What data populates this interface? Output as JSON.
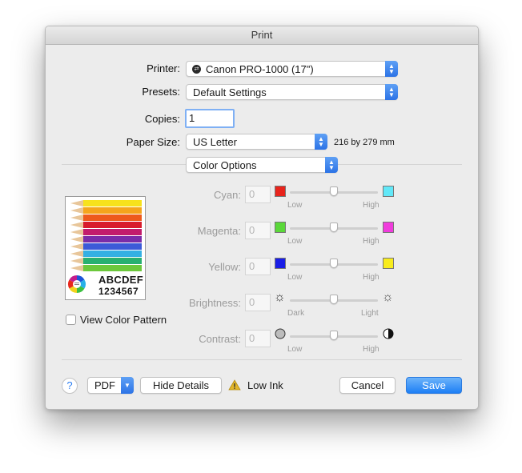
{
  "window": {
    "title": "Print"
  },
  "printer": {
    "label": "Printer:",
    "value": "Canon PRO-1000 (17\")"
  },
  "presets": {
    "label": "Presets:",
    "value": "Default Settings"
  },
  "copies": {
    "label": "Copies:",
    "value": "1"
  },
  "paper_size": {
    "label": "Paper Size:",
    "value": "US Letter",
    "dimensions": "216 by 279 mm"
  },
  "section": {
    "value": "Color Options"
  },
  "preview": {
    "text_line1": "ABCDEF",
    "text_line2": "1234567"
  },
  "view_color_pattern": {
    "label": "View Color Pattern",
    "checked": false
  },
  "sliders": [
    {
      "name": "Cyan:",
      "value": "0",
      "low_label": "Low",
      "high_label": "High",
      "left_color": "#e8241c",
      "right_color": "#62e8f8",
      "left_icon": "red-swatch-icon",
      "right_icon": "cyan-swatch-icon"
    },
    {
      "name": "Magenta:",
      "value": "0",
      "low_label": "Low",
      "high_label": "High",
      "left_color": "#5bd83a",
      "right_color": "#f03cdc",
      "left_icon": "green-swatch-icon",
      "right_icon": "magenta-swatch-icon"
    },
    {
      "name": "Yellow:",
      "value": "0",
      "low_label": "Low",
      "high_label": "High",
      "left_color": "#1a1ee6",
      "right_color": "#f8ec1c",
      "left_icon": "blue-swatch-icon",
      "right_icon": "yellow-swatch-icon"
    },
    {
      "name": "Brightness:",
      "value": "0",
      "low_label": "Dark",
      "high_label": "Light",
      "left_icon": "sun-dark-icon",
      "right_icon": "sun-light-icon"
    },
    {
      "name": "Contrast:",
      "value": "0",
      "low_label": "Low",
      "high_label": "High",
      "left_icon": "contrast-low-icon",
      "right_icon": "contrast-high-icon"
    }
  ],
  "footer": {
    "help": "?",
    "pdf": "PDF",
    "hide_details": "Hide Details",
    "status": "Low Ink",
    "cancel": "Cancel",
    "save": "Save"
  },
  "colors": {
    "accent": "#2c7ef2",
    "warning": "#e2b62a"
  }
}
